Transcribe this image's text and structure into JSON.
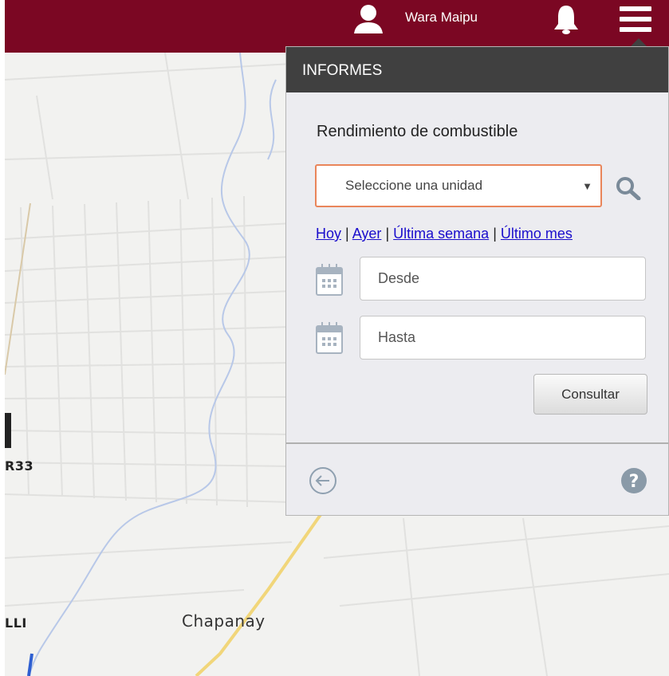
{
  "header": {
    "user_name": "Wara Maipu",
    "icons": [
      "user-icon",
      "bell-icon",
      "menu-icon"
    ],
    "background_color": "#7b0723"
  },
  "map": {
    "labels": [
      "R33",
      "Chapanay",
      "LLI"
    ]
  },
  "panel": {
    "header_title": "INFORMES",
    "report_title": "Rendimiento de combustible",
    "unit_select": {
      "selected": "Seleccione una unidad",
      "border_color": "#e9855a"
    },
    "quick_ranges": {
      "today": "Hoy",
      "yesterday": "Ayer",
      "last_week": "Última semana",
      "last_month": "Último mes",
      "separator": "|"
    },
    "from_field": {
      "placeholder": "Desde",
      "value": ""
    },
    "to_field": {
      "placeholder": "Hasta",
      "value": ""
    },
    "submit_label": "Consultar",
    "footer_icons": [
      "back-arrow-icon",
      "help-icon"
    ],
    "header_color": "#404040",
    "link_color": "#1a0dcc"
  }
}
